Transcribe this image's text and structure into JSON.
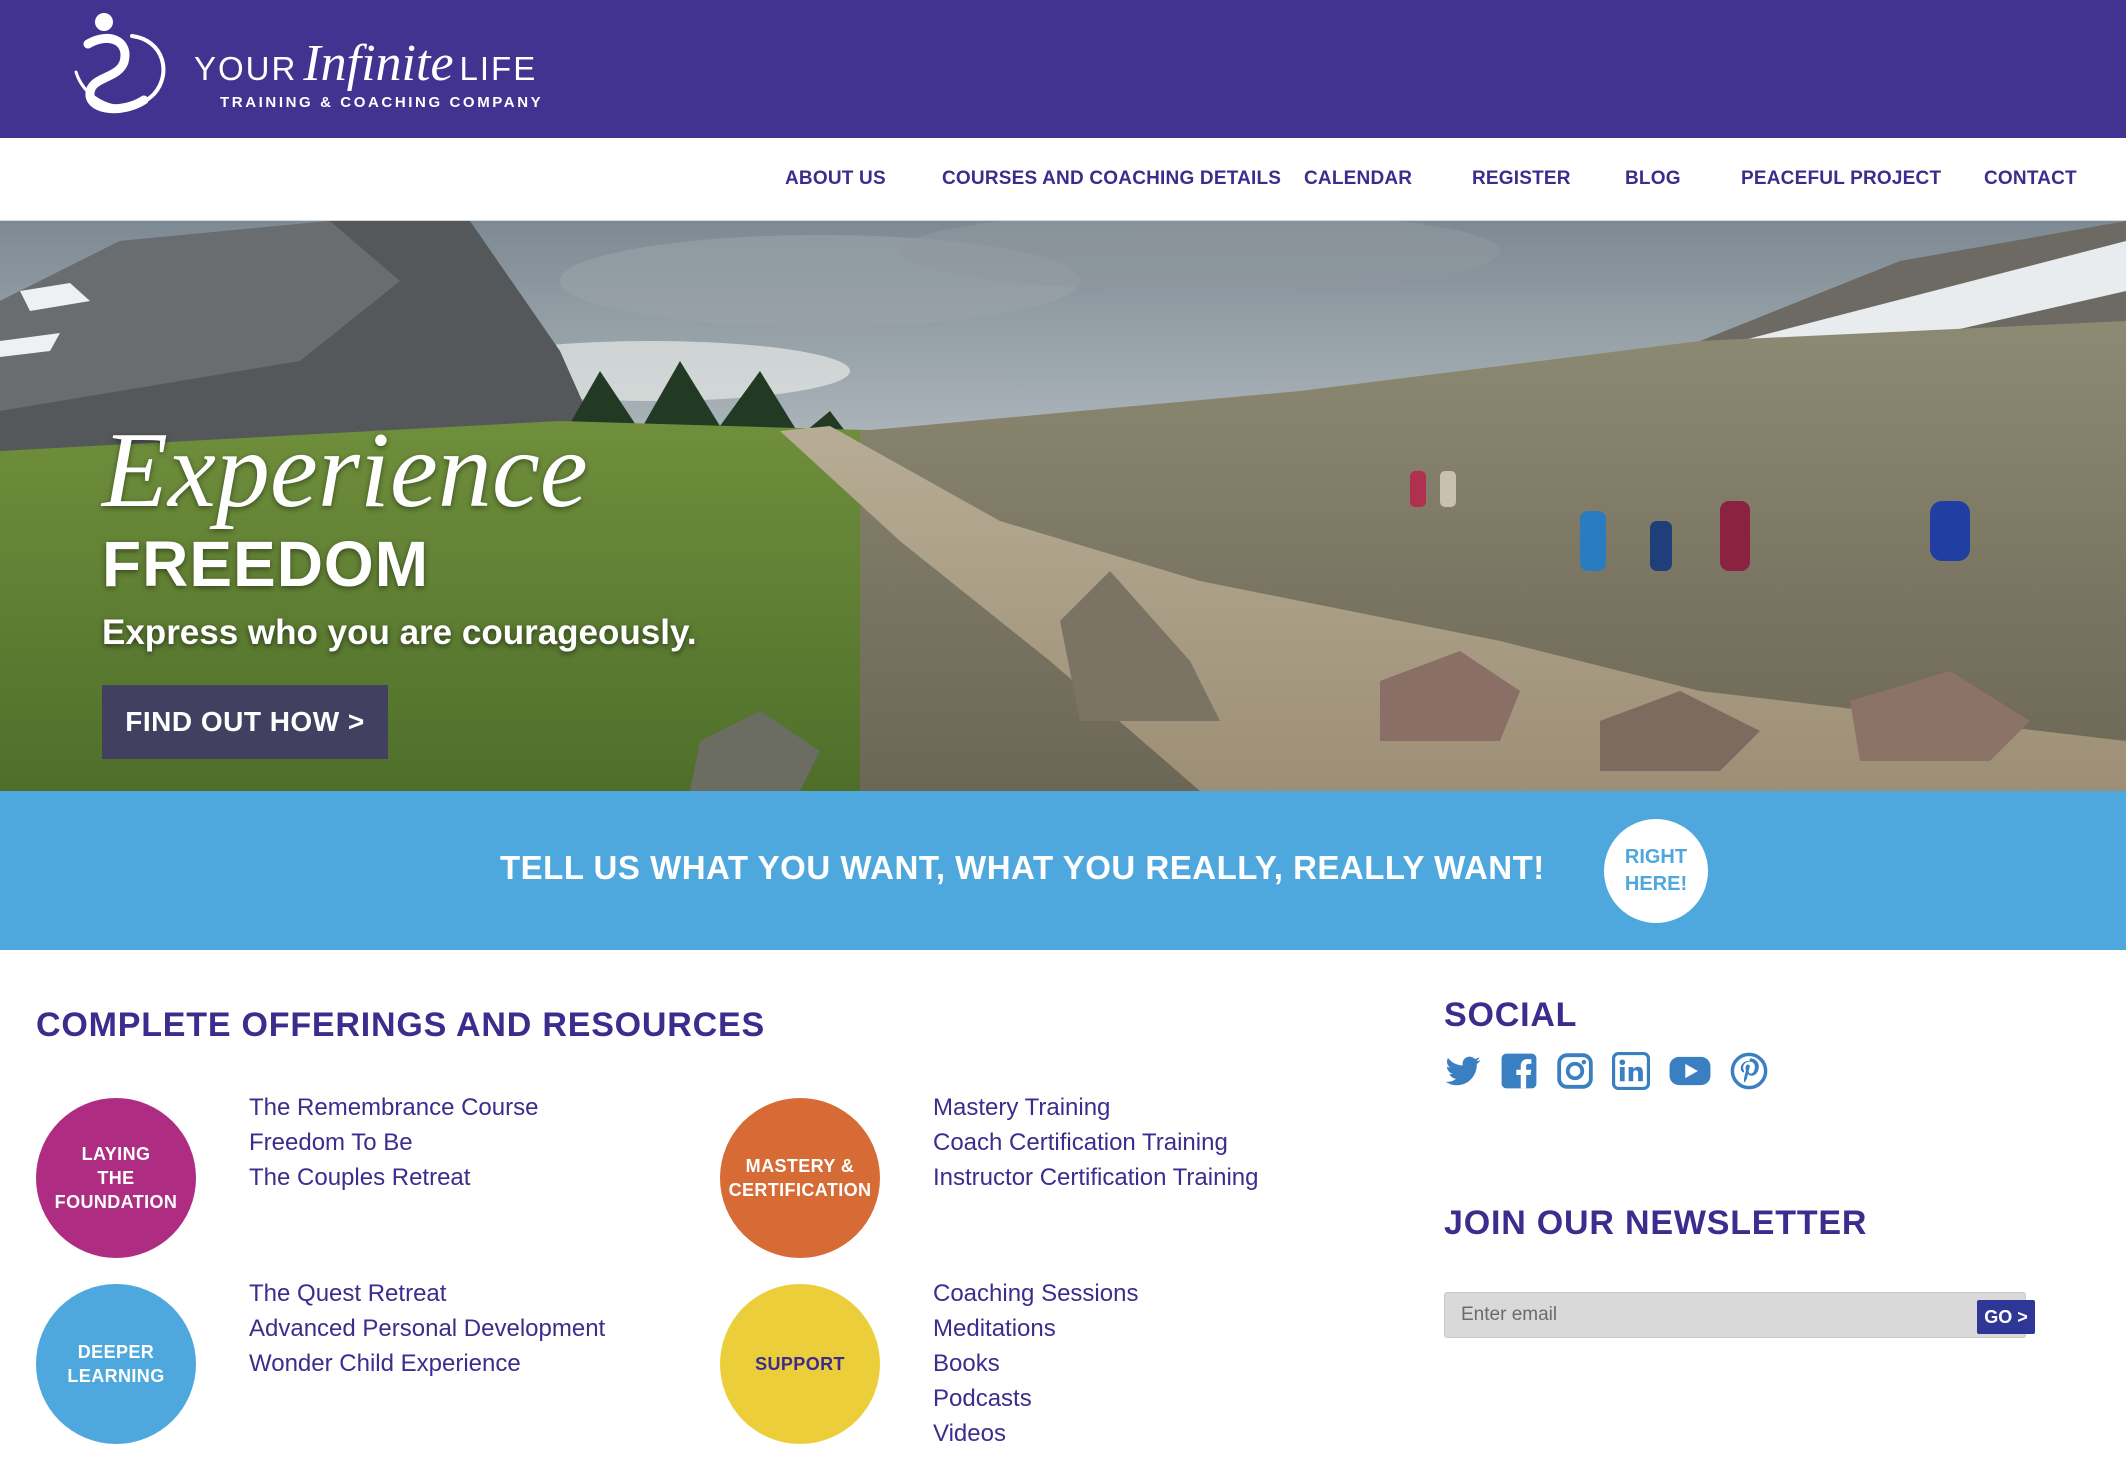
{
  "brand": {
    "word_your": "YOUR",
    "word_infinite": "Infinite",
    "word_life": "LIFE",
    "tagline": "TRAINING & COACHING COMPANY",
    "header_color": "#41338f"
  },
  "nav": {
    "items": [
      {
        "label": "ABOUT US"
      },
      {
        "label": "COURSES AND COACHING DETAILS"
      },
      {
        "label": "CALENDAR"
      },
      {
        "label": "REGISTER"
      },
      {
        "label": "BLOG"
      },
      {
        "label": "PEACEFUL PROJECT"
      },
      {
        "label": "CONTACT"
      }
    ]
  },
  "hero": {
    "headline_script": "Experience",
    "headline_bold": "FREEDOM",
    "subheadline": "Express who you are courageously.",
    "button_label": "FIND OUT HOW >"
  },
  "cta": {
    "text": "TELL US WHAT YOU WANT, WHAT YOU REALLY, REALLY WANT!",
    "circle_line1": "RIGHT",
    "circle_line2": "HERE!",
    "band_color": "#4ea8dd"
  },
  "offerings": {
    "title": "COMPLETE OFFERINGS AND RESOURCES",
    "groups": [
      {
        "badge_lines": [
          "LAYING",
          "THE",
          "FOUNDATION"
        ],
        "color": "#ae2d83",
        "links": [
          "The Remembrance Course",
          "Freedom To Be",
          "The Couples Retreat"
        ]
      },
      {
        "badge_lines": [
          "MASTERY &",
          "CERTIFICATION"
        ],
        "color": "#d76b35",
        "links": [
          "Mastery Training",
          "Coach Certification Training",
          "Instructor Certification Training"
        ]
      },
      {
        "badge_lines": [
          "DEEPER",
          "LEARNING"
        ],
        "color": "#4ea8dd",
        "links": [
          "The Quest Retreat",
          "Advanced Personal Development",
          "Wonder Child Experience"
        ]
      },
      {
        "badge_lines": [
          "SUPPORT"
        ],
        "color": "#ecce3a",
        "links": [
          "Coaching Sessions",
          "Meditations",
          "Books",
          "Podcasts",
          "Videos"
        ]
      }
    ]
  },
  "social": {
    "title": "SOCIAL",
    "icons": [
      "twitter-icon",
      "facebook-icon",
      "instagram-icon",
      "linkedin-icon",
      "youtube-icon",
      "pinterest-icon"
    ],
    "icon_color": "#3a7fc2"
  },
  "newsletter": {
    "title": "JOIN OUR NEWSLETTER",
    "email_placeholder": "Enter email",
    "go_label": "GO >"
  }
}
